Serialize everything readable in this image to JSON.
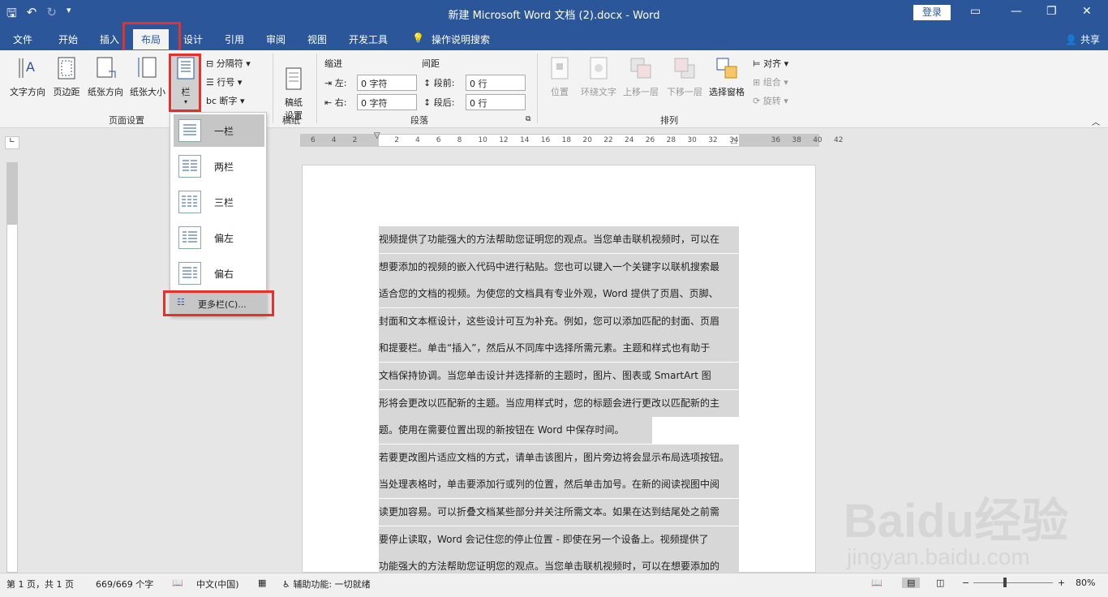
{
  "window": {
    "title": "新建 Microsoft Word 文档 (2).docx  -  Word",
    "login": "登录"
  },
  "tabs": [
    "文件",
    "开始",
    "插入",
    "布局",
    "设计",
    "引用",
    "审阅",
    "视图",
    "开发工具",
    "操作说明搜索"
  ],
  "share": "共享",
  "ribbon": {
    "page_setup": {
      "text_direction": "文字方向",
      "margins": "页边距",
      "orientation": "纸张方向",
      "size": "纸张大小",
      "columns": "栏",
      "breaks": "分隔符",
      "line_numbers": "行号",
      "hyphenation": "断字",
      "group": "页面设置"
    },
    "draft": {
      "label": "稿纸\n设置",
      "group": "稿纸"
    },
    "paragraph": {
      "indent": "缩进",
      "spacing": "间距",
      "left": "左:",
      "right": "右:",
      "before": "段前:",
      "after": "段后:",
      "left_val": "0 字符",
      "right_val": "0 字符",
      "before_val": "0 行",
      "after_val": "0 行",
      "group": "段落"
    },
    "arrange": {
      "position": "位置",
      "wrap": "环绕文字",
      "forward": "上移一层",
      "backward": "下移一层",
      "selection": "选择窗格",
      "align": "对齐",
      "group_btn": "组合",
      "rotate": "旋转",
      "group": "排列"
    }
  },
  "columns_menu": {
    "items": [
      "一栏",
      "两栏",
      "三栏",
      "偏左",
      "偏右"
    ],
    "more": "更多栏(C)..."
  },
  "ruler": {
    "ticks": [
      "6",
      "4",
      "2",
      "",
      "2",
      "4",
      "6",
      "8",
      "10",
      "12",
      "14",
      "16",
      "18",
      "20",
      "22",
      "24",
      "26",
      "28",
      "30",
      "32",
      "34",
      "",
      "36",
      "38",
      "40",
      "42"
    ]
  },
  "document": {
    "lines": [
      "视频提供了功能强大的方法帮助您证明您的观点。当您单击联机视频时，可以在",
      "想要添加的视频的嵌入代码中进行粘贴。您也可以键入一个关键字以联机搜索最",
      "适合您的文档的视频。为使您的文档具有专业外观，Word 提供了页眉、页脚、",
      "封面和文本框设计，这些设计可互为补充。例如，您可以添加匹配的封面、页眉",
      "和提要栏。单击“插入”，然后从不同库中选择所需元素。主题和样式也有助于",
      "文档保持协调。当您单击设计并选择新的主题时，图片、图表或 SmartArt 图",
      "形将会更改以匹配新的主题。当应用样式时，您的标题会进行更改以匹配新的主",
      "题。使用在需要位置出现的新按钮在 Word 中保存时间。",
      "若要更改图片适应文档的方式，请单击该图片，图片旁边将会显示布局选项按钮。",
      "当处理表格时，单击要添加行或列的位置，然后单击加号。在新的阅读视图中阅",
      "读更加容易。可以折叠文档某些部分并关注所需文本。如果在达到结尾处之前需",
      "要停止读取，Word 会记住您的停止位置 - 即使在另一个设备上。视频提供了",
      "功能强大的方法帮助您证明您的观点。当您单击联机视频时，可以在想要添加的"
    ]
  },
  "status": {
    "page": "第 1 页，共 1 页",
    "words": "669/669 个字",
    "lang": "中文(中国)",
    "access": "辅助功能: 一切就绪",
    "zoom": "80%"
  },
  "watermark": {
    "brand": "Baidu经验",
    "url": "jingyan.baidu.com"
  }
}
